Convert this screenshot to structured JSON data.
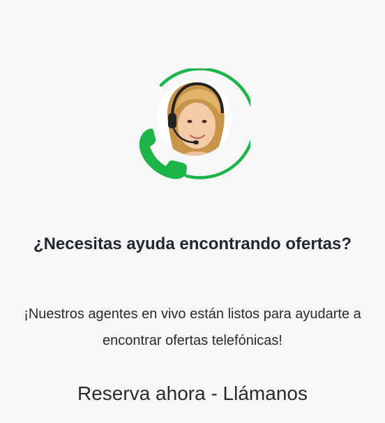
{
  "colors": {
    "accent": "#1db54a",
    "background": "#f7f7f7",
    "text": "#222222"
  },
  "illustration": {
    "agent_photo": "agent-with-headset",
    "phone_icon": "phone-icon"
  },
  "heading": "¿Necesitas ayuda encontrando ofertas?",
  "subtext": "¡Nuestros agentes en vivo están listos para ayudarte a encontrar ofertas telefónicas!",
  "cta_label": "Reserva ahora - Llámanos"
}
